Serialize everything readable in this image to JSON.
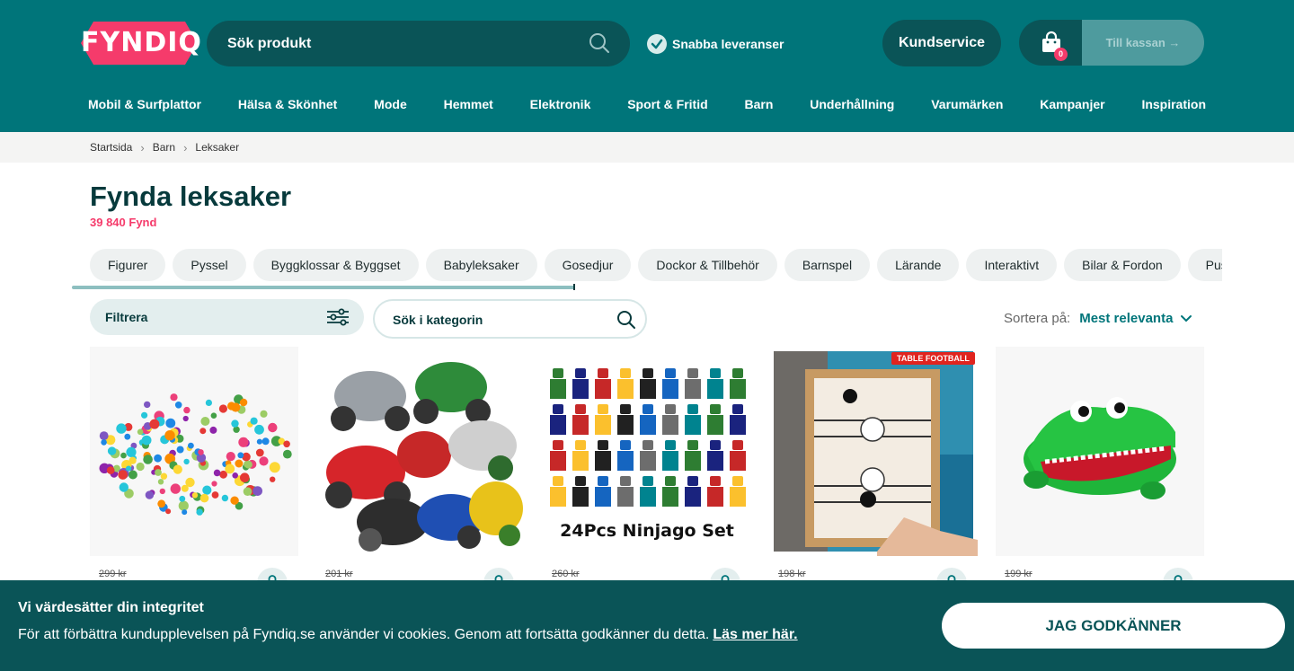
{
  "brand": {
    "name": "FYNDIQ",
    "color": "#f53b6b",
    "header_color": "#00757a"
  },
  "header": {
    "search_placeholder": "Sök produkt",
    "fast_delivery": "Snabba leveranser",
    "customer_service": "Kundservice",
    "cart_count": "0",
    "checkout": "Till kassan →"
  },
  "nav": [
    "Mobil & Surfplattor",
    "Hälsa & Skönhet",
    "Mode",
    "Hemmet",
    "Elektronik",
    "Sport & Fritid",
    "Barn",
    "Underhållning",
    "Varumärken",
    "Kampanjer",
    "Inspiration"
  ],
  "breadcrumb": [
    "Startsida",
    "Barn",
    "Leksaker"
  ],
  "page": {
    "title": "Fynda leksaker",
    "count": "39 840 Fynd"
  },
  "categories": [
    "Figurer",
    "Pyssel",
    "Byggklossar & Byggset",
    "Babyleksaker",
    "Gosedjur",
    "Dockor & Tillbehör",
    "Barnspel",
    "Lärande",
    "Interaktivt",
    "Bilar & Fordon",
    "Pussel"
  ],
  "category_scroll": 0.5,
  "filter": {
    "label": "Filtrera",
    "search_placeholder": "Sök i kategorin"
  },
  "sort": {
    "label": "Sortera på:",
    "value": "Mest relevanta"
  },
  "products": [
    {
      "old_price": "299 kr",
      "image": "mini-figures"
    },
    {
      "old_price": "201 kr",
      "image": "ninja-motorbikes"
    },
    {
      "old_price": "260 kr",
      "image": "ninjago-set",
      "image_text": "24Pcs Ninjago Set"
    },
    {
      "old_price": "198 kr",
      "image": "table-football",
      "image_text": "TABLE FOOTBALL"
    },
    {
      "old_price": "199 kr",
      "image": "crocodile-toy"
    }
  ],
  "cookie": {
    "heading": "Vi värdesätter din integritet",
    "text": "För att förbättra kundupplevelsen på Fyndiq.se använder vi cookies. Genom att fortsätta godkänner du detta.",
    "link": "Läs mer här.",
    "accept": "JAG GODKÄNNER"
  }
}
